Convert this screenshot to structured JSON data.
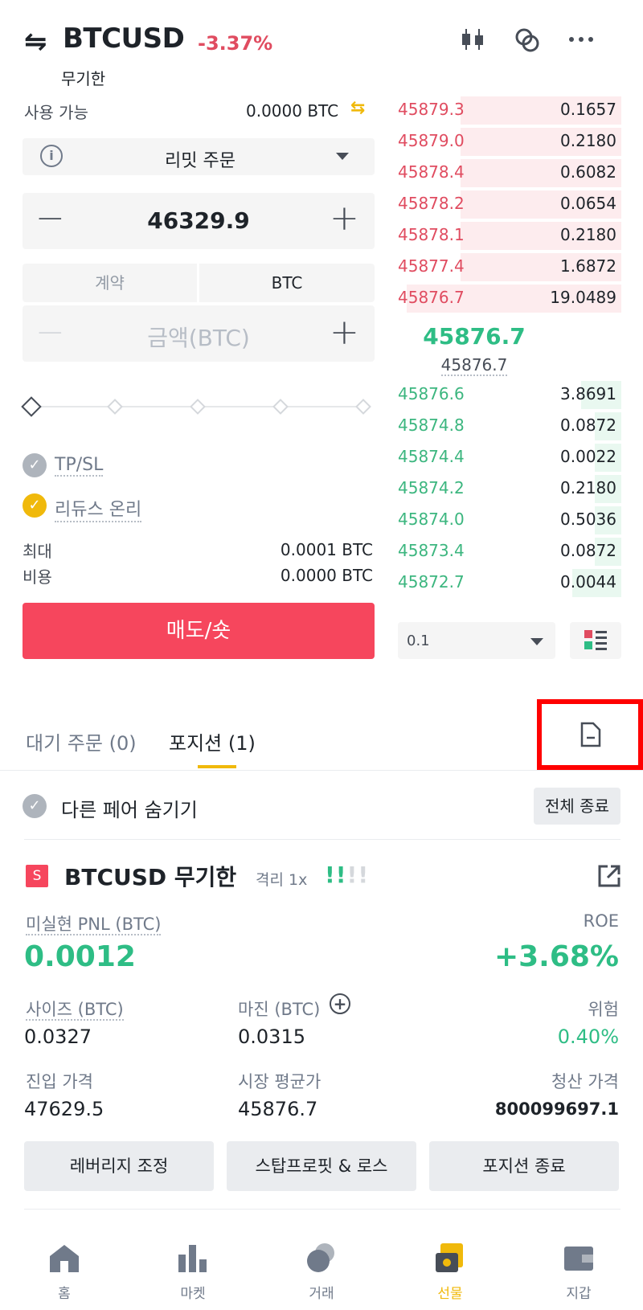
{
  "header": {
    "pair": "BTCUSD",
    "change": "-3.37%",
    "subtitle": "무기한",
    "icons": [
      "swap-icon",
      "candlestick-chart-icon",
      "link-icon",
      "more-icon"
    ]
  },
  "order_form": {
    "available_label": "사용 가능",
    "available_value": "0.0000 BTC",
    "order_type": "리밋 주문",
    "price": "46329.9",
    "unit_tabs": [
      "계약",
      "BTC"
    ],
    "amount_placeholder": "금액(BTC)",
    "slider_percent": 0,
    "tpsl_label": "TP/SL",
    "reduce_only_label": "리듀스 온리",
    "max_label": "최대",
    "max_value": "0.0001 BTC",
    "cost_label": "비용",
    "cost_value": "0.0000 BTC",
    "sell_button": "매도/숏"
  },
  "order_book": {
    "asks": [
      {
        "price": "45879.3",
        "qty": "0.1657"
      },
      {
        "price": "45879.0",
        "qty": "0.2180"
      },
      {
        "price": "45878.4",
        "qty": "0.6082"
      },
      {
        "price": "45878.2",
        "qty": "0.0654"
      },
      {
        "price": "45878.1",
        "qty": "0.2180"
      },
      {
        "price": "45877.4",
        "qty": "1.6872"
      },
      {
        "price": "45876.7",
        "qty": "19.0489"
      }
    ],
    "last_price": "45876.7",
    "mark_price": "45876.7",
    "bids": [
      {
        "price": "45876.6",
        "qty": "3.8691"
      },
      {
        "price": "45874.8",
        "qty": "0.0872"
      },
      {
        "price": "45874.4",
        "qty": "0.0022"
      },
      {
        "price": "45874.2",
        "qty": "0.2180"
      },
      {
        "price": "45874.0",
        "qty": "0.5036"
      },
      {
        "price": "45873.4",
        "qty": "0.0872"
      },
      {
        "price": "45872.7",
        "qty": "0.0044"
      }
    ],
    "depth_value": "0.1"
  },
  "tabs": {
    "open_orders": "대기 주문 (0)",
    "positions": "포지션 (1)"
  },
  "positions": {
    "hide_other_pairs": "다른 페어 숨기기",
    "close_all": "전체 종료",
    "side_badge": "S",
    "title": "BTCUSD 무기한",
    "margin_mode": "격리 1x",
    "pnl_label": "미실현 PNL (BTC)",
    "pnl_value": "0.0012",
    "roe_label": "ROE",
    "roe_value": "+3.68%",
    "size_label": "사이즈 (BTC)",
    "size_value": "0.0327",
    "margin_label": "마진 (BTC)",
    "margin_value": "0.0315",
    "risk_label": "위험",
    "risk_value": "0.40%",
    "entry_label": "진입 가격",
    "entry_value": "47629.5",
    "mark_label": "시장 평균가",
    "mark_value": "45876.7",
    "liq_label": "청산 가격",
    "liq_value": "800099697.1",
    "buttons": [
      "레버리지 조정",
      "스탑프로핏 & 로스",
      "포지션 종료"
    ]
  },
  "bottom_nav": [
    {
      "label": "홈",
      "icon": "home-icon"
    },
    {
      "label": "마켓",
      "icon": "markets-icon"
    },
    {
      "label": "거래",
      "icon": "trade-icon"
    },
    {
      "label": "선물",
      "icon": "futures-icon",
      "active": true
    },
    {
      "label": "지갑",
      "icon": "wallet-icon"
    }
  ],
  "colors": {
    "ask": "#e04c60",
    "bid": "#2ebd85",
    "accent": "#f0b90b",
    "sell": "#f6465d"
  }
}
